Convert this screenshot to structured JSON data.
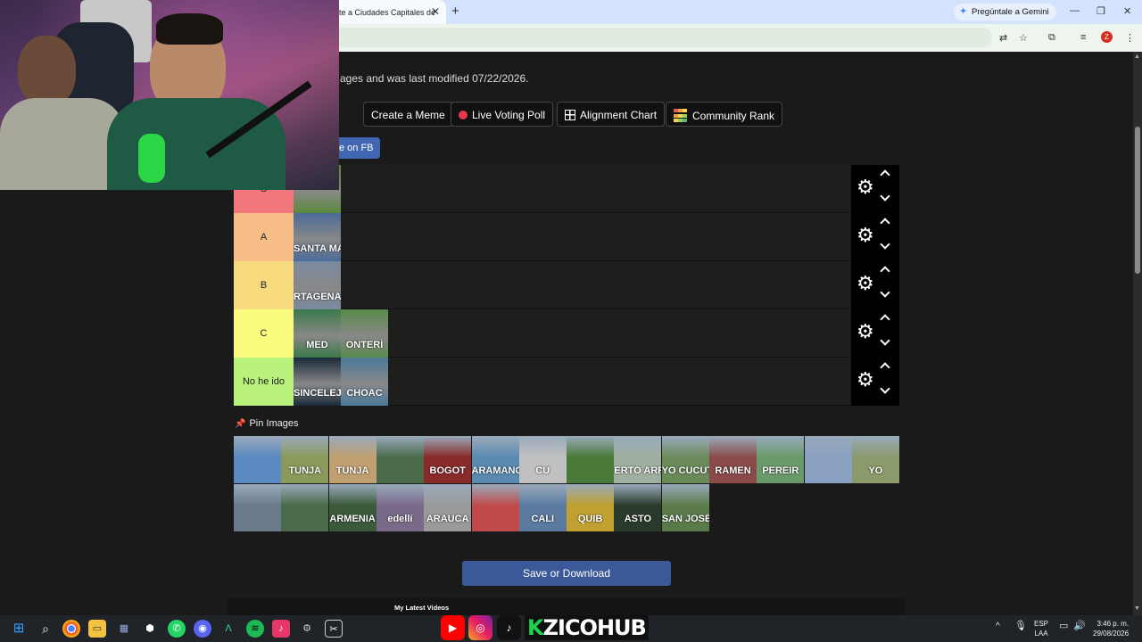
{
  "browser": {
    "tab_title": "te a Ciudades Capitales de",
    "gemini_label": "Pregúntale a Gemini",
    "profile_initial": "Z"
  },
  "page": {
    "info_text": "ages and was last modified 07/22/2026.",
    "buttons": {
      "create_meme": "Create a Meme",
      "live_voting": "Live Voting Poll",
      "alignment": "Alignment Chart",
      "community": "Community Rank"
    },
    "fb_button": "e on FB",
    "tiers": [
      {
        "label": "S",
        "color": "#f2777d",
        "items": 1,
        "images": [
          "#5a8a3a"
        ],
        "captions": [
          ""
        ]
      },
      {
        "label": "A",
        "color": "#f7be88",
        "items": 1,
        "images": [
          "#4a6a9a"
        ],
        "captions": [
          "SANTA MA"
        ]
      },
      {
        "label": "B",
        "color": "#f8da7f",
        "items": 1,
        "images": [
          "#7a8aa0"
        ],
        "captions": [
          "RTAGENA"
        ]
      },
      {
        "label": "C",
        "color": "#fbfc7f",
        "items": 2,
        "images": [
          "#3a7a4a",
          "#5a8a4a"
        ],
        "captions": [
          "MED",
          "ONTERÍ"
        ]
      },
      {
        "label": "No he ido",
        "color": "#b8f27d",
        "items": 2,
        "images": [
          "#1a2a3a",
          "#4a7a9a"
        ],
        "captions": [
          "SINCELEJ",
          "CHOAC"
        ]
      }
    ],
    "pin_images_label": "Pin Images",
    "pool_images": [
      {
        "color": "#5a8ac0",
        "caption": ""
      },
      {
        "color": "#8a9a5a",
        "caption": "TUNJA"
      },
      {
        "color": "#c0a070",
        "caption": "TUNJA"
      },
      {
        "color": "#4a6a4a",
        "caption": ""
      },
      {
        "color": "#8a2a2a",
        "caption": "BOGOT"
      },
      {
        "color": "#5a8ab0",
        "caption": "ARAMANG"
      },
      {
        "color": "#c0c0c0",
        "caption": "CÚ"
      },
      {
        "color": "#4a7a3a",
        "caption": ""
      },
      {
        "color": "#a0b0a0",
        "caption": "ERTO ARRE"
      },
      {
        "color": "#6a8a5a",
        "caption": "YO CUCUT"
      },
      {
        "color": "#8a4a4a",
        "caption": "RAMEN"
      },
      {
        "color": "#6a9a6a",
        "caption": "PEREIR"
      },
      {
        "color": "#8aa0c0",
        "caption": ""
      },
      {
        "color": "#8a9a6a",
        "caption": "YO"
      },
      {
        "color": "#6a7a8a",
        "caption": ""
      },
      {
        "color": "#4a6a4a",
        "caption": ""
      },
      {
        "color": "#3a5a3a",
        "caption": "ARMENIA"
      },
      {
        "color": "#7a6a8a",
        "caption": "edellí"
      },
      {
        "color": "#9a9a9a",
        "caption": "ARAUCA"
      },
      {
        "color": "#c04a4a",
        "caption": ""
      },
      {
        "color": "#5a7aa0",
        "caption": "CALI"
      },
      {
        "color": "#c0a030",
        "caption": "QUIB"
      },
      {
        "color": "#2a3a2a",
        "caption": "ASTO"
      },
      {
        "color": "#5a7a4a",
        "caption": "SAN JOSÉ"
      }
    ],
    "save_label": "Save or Download",
    "videos_title": "My Latest Videos"
  },
  "taskbar": {
    "brand_k": "K",
    "brand_rest": "ZICOHUB",
    "lang_1": "ESP",
    "lang_2": "LAA",
    "time": "3:46 p. m.",
    "date": "29/08/2026"
  }
}
